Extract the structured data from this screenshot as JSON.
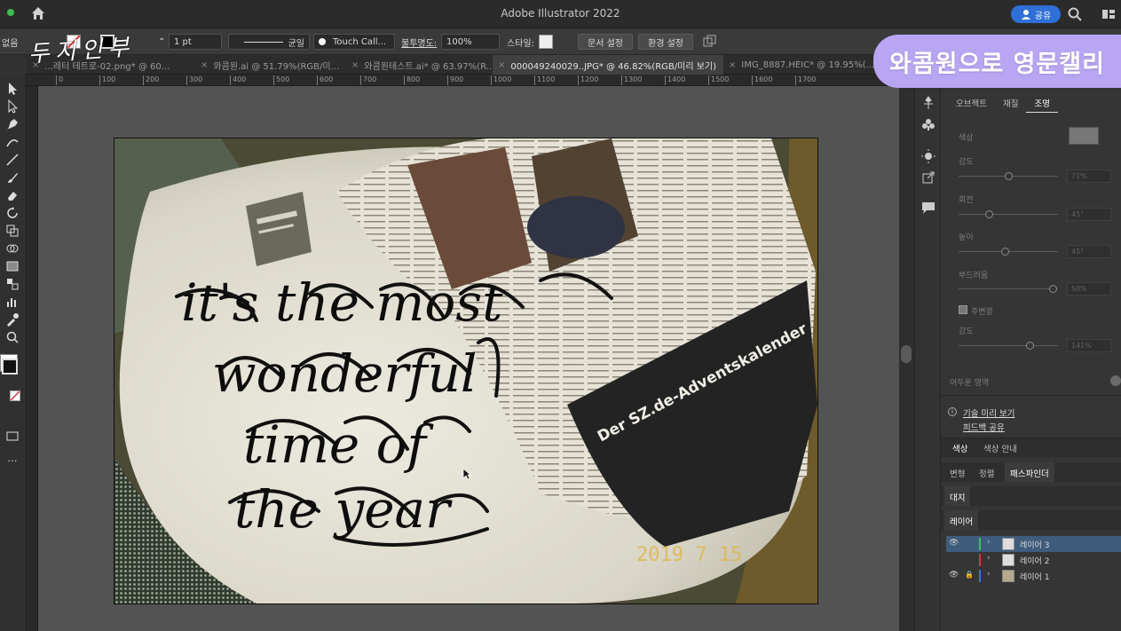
{
  "titlebar": {
    "title": "Adobe Illustrator 2022",
    "share_label": "공유"
  },
  "control_bar": {
    "left_label": "없음",
    "stroke_weight": "1 pt",
    "profile_label": "균일",
    "brush_name": "Touch Call...",
    "opacity_label": "불투명도:",
    "opacity_value": "100%",
    "style_label": "스타일:",
    "doc_setup": "문서 설정",
    "preferences": "환경 설정"
  },
  "tabs": [
    {
      "label": "...레터 테트로-02.png* @ 60..."
    },
    {
      "label": "와콤원.ai @ 51.79%(RGB/미..."
    },
    {
      "label": "와콤원테스트.ai* @ 63.97%(R..."
    },
    {
      "label": "000049240029..JPG* @ 46.82%(RGB/미리 보기)",
      "active": true
    },
    {
      "label": "IMG_8887.HEIC* @ 19.95%(..."
    }
  ],
  "ruler_ticks": [
    "0",
    "100",
    "200",
    "300",
    "400",
    "500",
    "600",
    "700",
    "800",
    "900",
    "1000",
    "1100",
    "1200",
    "1300",
    "1400",
    "1500",
    "1600",
    "1700"
  ],
  "artwork": {
    "lettering_lines": [
      "it's the most",
      "wonderful",
      "time of",
      "the year"
    ],
    "date_stamp": "2019  7 15",
    "newspaper_banner": "Der SZ.de-Adventskalender"
  },
  "overlay": {
    "logo_text": "와콤원으로 영문캘리",
    "handwriting": "두지인부"
  },
  "right_panel": {
    "tabs": [
      "오브젝트",
      "재질",
      "조명"
    ],
    "active_tab": "조명",
    "labels": {
      "color": "색상",
      "intensity": "강도",
      "rotation": "회전",
      "height": "높이",
      "softness": "부드러움",
      "ambient": "주변광",
      "ambient_intensity": "강도",
      "dark_area": "어두운 영역"
    },
    "values": {
      "intensity": "71%",
      "rotation": "45°",
      "height": "45°",
      "softness": "50%",
      "ambient_intensity": "141%"
    },
    "tech_preview": "기술 미리 보기",
    "feedback": "피드백 공유",
    "panel_tabs_1": [
      "색상",
      "색상 안내"
    ],
    "panel_tabs_2": [
      "변형",
      "정렬",
      "패스파인더"
    ],
    "artboard_tab": "대지",
    "layers_tab": "레이어",
    "layers": [
      {
        "name": "레이어 3",
        "color": "#35c25b",
        "visible": true,
        "locked": false,
        "selected": true
      },
      {
        "name": "레이어 2",
        "color": "#d03a3a",
        "visible": false,
        "locked": false,
        "selected": false
      },
      {
        "name": "레이어 1",
        "color": "#3f6ee0",
        "visible": true,
        "locked": true,
        "selected": false
      }
    ]
  },
  "colors": {
    "accent": "#2f6fd7",
    "logo_bg": "#b9a6f2",
    "layer_selected": "#3f5c7c"
  }
}
